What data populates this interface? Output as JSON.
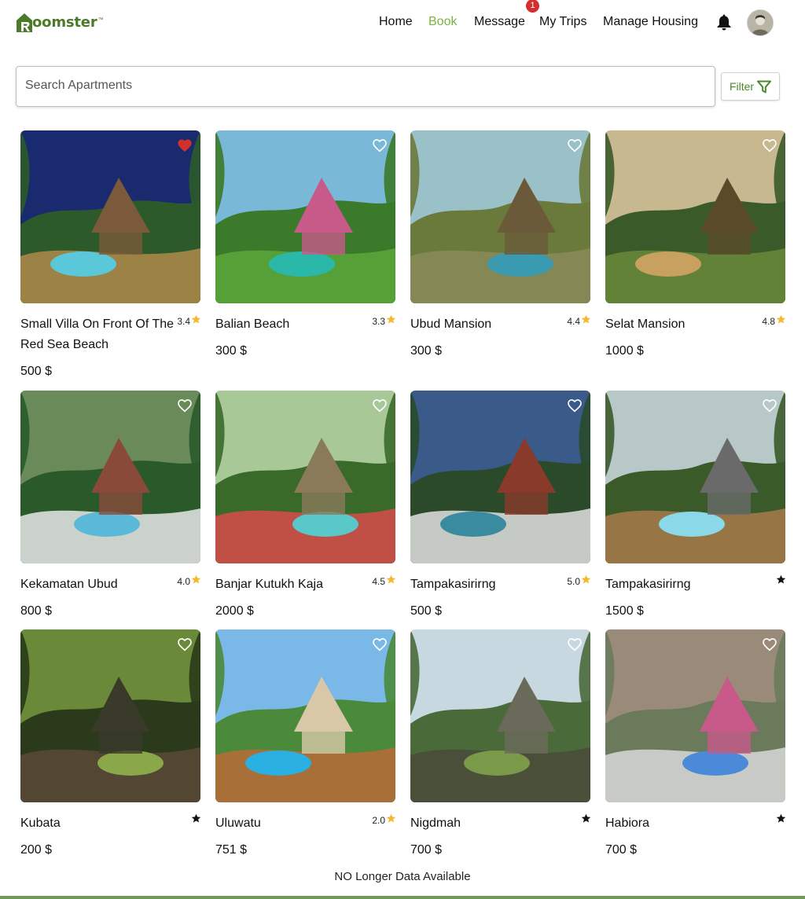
{
  "brand": {
    "name": "oomster",
    "tm": "™",
    "color": "#4a7a2a"
  },
  "nav": {
    "items": [
      {
        "label": "Home",
        "active": false
      },
      {
        "label": "Book",
        "active": true
      },
      {
        "label": "Message",
        "active": false
      },
      {
        "label": "My Trips",
        "active": false
      },
      {
        "label": "Manage Housing",
        "active": false
      }
    ],
    "message_badge": "1",
    "active_color": "#7cb342"
  },
  "search": {
    "placeholder": "Search Apartments",
    "value": ""
  },
  "filter": {
    "label": "Filter",
    "icon": "funnel-icon"
  },
  "listings": [
    {
      "title": "Small Villa On Front Of The Red Sea Beach",
      "price": "500 $",
      "rating": "3.4",
      "favorited": true
    },
    {
      "title": "Balian Beach",
      "price": "300 $",
      "rating": "3.3",
      "favorited": false
    },
    {
      "title": "Ubud Mansion",
      "price": "300 $",
      "rating": "4.4",
      "favorited": false
    },
    {
      "title": "Selat Mansion",
      "price": "1000 $",
      "rating": "4.8",
      "favorited": false
    },
    {
      "title": "Kekamatan Ubud",
      "price": "800 $",
      "rating": "4.0",
      "favorited": false
    },
    {
      "title": "Banjar Kutukh Kaja",
      "price": "2000 $",
      "rating": "4.5",
      "favorited": false
    },
    {
      "title": "Tampakasirirng",
      "price": "500 $",
      "rating": "5.0",
      "favorited": false
    },
    {
      "title": "Tampakasirirng",
      "price": "1500 $",
      "rating": "",
      "favorited": false
    },
    {
      "title": "Kubata",
      "price": "200 $",
      "rating": "",
      "favorited": false
    },
    {
      "title": "Uluwatu",
      "price": "751 $",
      "rating": "2.0",
      "favorited": false
    },
    {
      "title": "Nigdmah",
      "price": "700 $",
      "rating": "",
      "favorited": false
    },
    {
      "title": "Habiora",
      "price": "700 $",
      "rating": "",
      "favorited": false
    }
  ],
  "end_message": "NO Longer Data Available",
  "colors": {
    "star_rated": "#f5b82e",
    "star_unrated": "#111111",
    "heart_fav": "#d32f2f",
    "bottom_bar": "#6f9a5a"
  }
}
